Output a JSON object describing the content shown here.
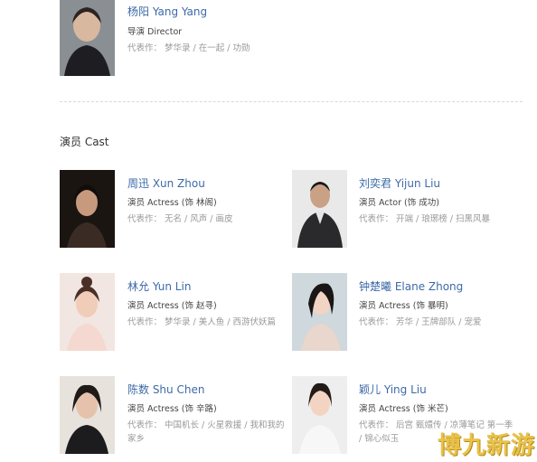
{
  "director": {
    "name": "杨阳 Yang Yang",
    "role": "导演 Director",
    "works": "代表作： 梦华录 / 在一起 / 功勋"
  },
  "cast_section_title": "演员 Cast",
  "cast": [
    {
      "name": "周迅 Xun Zhou",
      "role": "演员 Actress (饰 林阁)",
      "works": "代表作： 无名 / 风声 / 画皮",
      "works2": ""
    },
    {
      "name": "刘奕君 Yijun Liu",
      "role": "演员 Actor (饰 成功)",
      "works": "代表作： 开端 / 琅琊榜 / 扫黑风暴",
      "works2": ""
    },
    {
      "name": "林允 Yun Lin",
      "role": "演员 Actress (饰 赵寻)",
      "works": "代表作： 梦华录 / 美人鱼 / 西游伏妖篇",
      "works2": ""
    },
    {
      "name": "钟楚曦 Elane Zhong",
      "role": "演员 Actress (饰 暴明)",
      "works": "代表作： 芳华 / 王牌部队 / 宠爱",
      "works2": ""
    },
    {
      "name": "陈数 Shu Chen",
      "role": "演员 Actress (饰 辛路)",
      "works": "代表作： 中国机长 / 火星救援 / 我和我的",
      "works2": "家乡"
    },
    {
      "name": "颖儿 Ying Liu",
      "role": "演员 Actress (饰 米芒)",
      "works": "代表作： 后宫 甄嬛传 / 凉薄笔记 第一季",
      "works2": "/ 锦心似玉"
    }
  ],
  "watermark": "博九新游"
}
